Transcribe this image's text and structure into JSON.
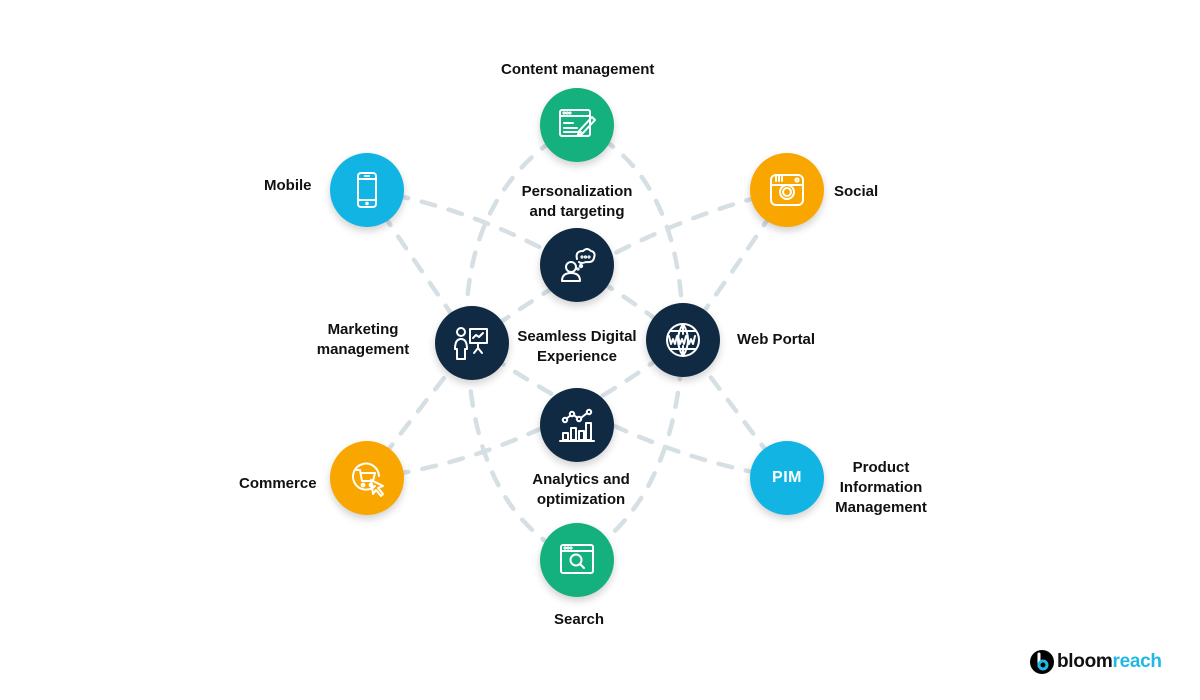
{
  "diagram": {
    "title": "Seamless Digital Experience",
    "center_label_line1": "Seamless Digital",
    "center_label_line2": "Experience",
    "nodes": {
      "content_management": {
        "label": "Content management",
        "icon": "content-edit-icon",
        "color": "#14B07E"
      },
      "mobile": {
        "label": "Mobile",
        "icon": "smartphone-icon",
        "color": "#12B4E3"
      },
      "social": {
        "label": "Social",
        "icon": "camera-icon",
        "color": "#F9A600"
      },
      "personalization": {
        "label_line1": "Personalization",
        "label_line2": "and targeting",
        "icon": "person-thought-icon",
        "color": "#0F2A42"
      },
      "marketing": {
        "label_line1": "Marketing",
        "label_line2": "management",
        "icon": "presenter-chart-icon",
        "color": "#0F2A42"
      },
      "web_portal": {
        "label": "Web Portal",
        "icon": "www-globe-icon",
        "color": "#0F2A42"
      },
      "analytics": {
        "label_line1": "Analytics and",
        "label_line2": "optimization",
        "icon": "analytics-chart-icon",
        "color": "#0F2A42"
      },
      "commerce": {
        "label": "Commerce",
        "icon": "cart-click-icon",
        "color": "#F9A600"
      },
      "pim": {
        "label_line1": "Product",
        "label_line2": "Information",
        "label_line3": "Management",
        "icon_text": "PIM",
        "color": "#12B4E3"
      },
      "search": {
        "label": "Search",
        "icon": "search-window-icon",
        "color": "#14B07E"
      }
    },
    "connector_color": "#D5DFE4"
  },
  "brand": {
    "logo_part1": "bloom",
    "logo_part2": "reach",
    "accent": "#22B8E6"
  }
}
